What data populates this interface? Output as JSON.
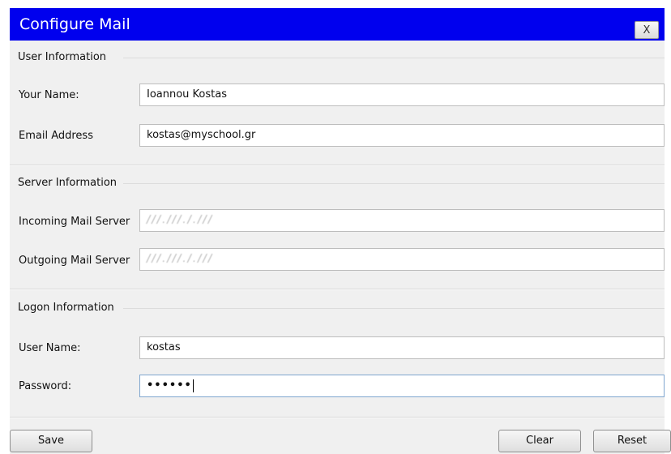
{
  "window": {
    "title": "Configure Mail",
    "close_label": "X"
  },
  "user_information": {
    "heading": "User Information",
    "your_name": {
      "label": "Your Name:",
      "value": "Ioannou Kostas"
    },
    "email_address": {
      "label": "Email Address",
      "value": "kostas@myschool.gr"
    }
  },
  "server_information": {
    "heading": "Server Information",
    "incoming_server": {
      "label": "Incoming Mail Server",
      "value": "///.///././//"
    },
    "outgoing_server": {
      "label": "Outgoing Mail Server",
      "value": "///.///././//"
    }
  },
  "logon_information": {
    "heading": "Logon Information",
    "user_name": {
      "label": "User Name:",
      "value": "kostas"
    },
    "password": {
      "label": "Password:",
      "value": "••••••"
    }
  },
  "buttons": {
    "save": "Save",
    "clear": "Clear",
    "reset": "Reset"
  },
  "colors": {
    "title_bar": "#0000ee",
    "dialog_background": "#f0f0f0"
  }
}
